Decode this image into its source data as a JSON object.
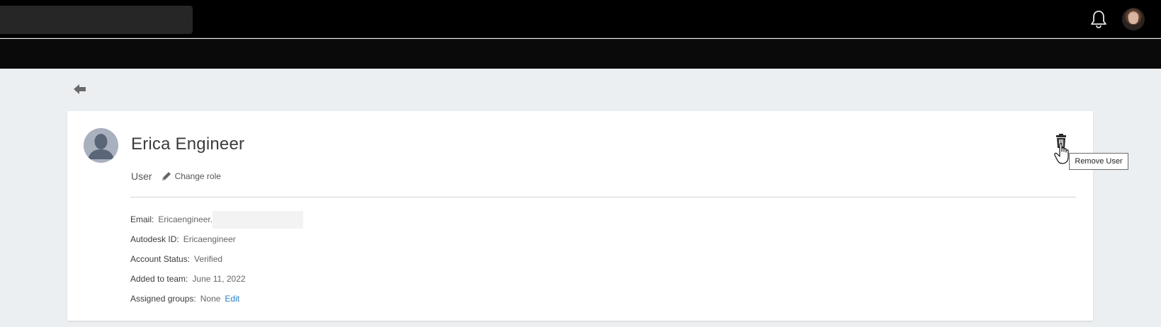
{
  "header": {
    "search_placeholder": "",
    "bell_icon": "bell-icon",
    "avatar_icon": "user-avatar"
  },
  "nav": {
    "back_icon": "arrow-left-icon"
  },
  "profile": {
    "name": "Erica Engineer",
    "role": "User",
    "change_role_label": "Change role",
    "details": {
      "email_label": "Email:",
      "email_value": "Ericaengineer.",
      "autodesk_id_label": "Autodesk ID:",
      "autodesk_id_value": "Ericaengineer",
      "status_label": "Account Status:",
      "status_value": "Verified",
      "added_label": "Added to team:",
      "added_value": "June 11, 2022",
      "groups_label": "Assigned groups:",
      "groups_value": "None",
      "groups_edit_label": "Edit"
    },
    "remove_tooltip": "Remove User"
  },
  "colors": {
    "topbar": "#000000",
    "subbar": "#0a0a0a",
    "page_bg": "#eceff2",
    "link": "#2a7fc4"
  }
}
